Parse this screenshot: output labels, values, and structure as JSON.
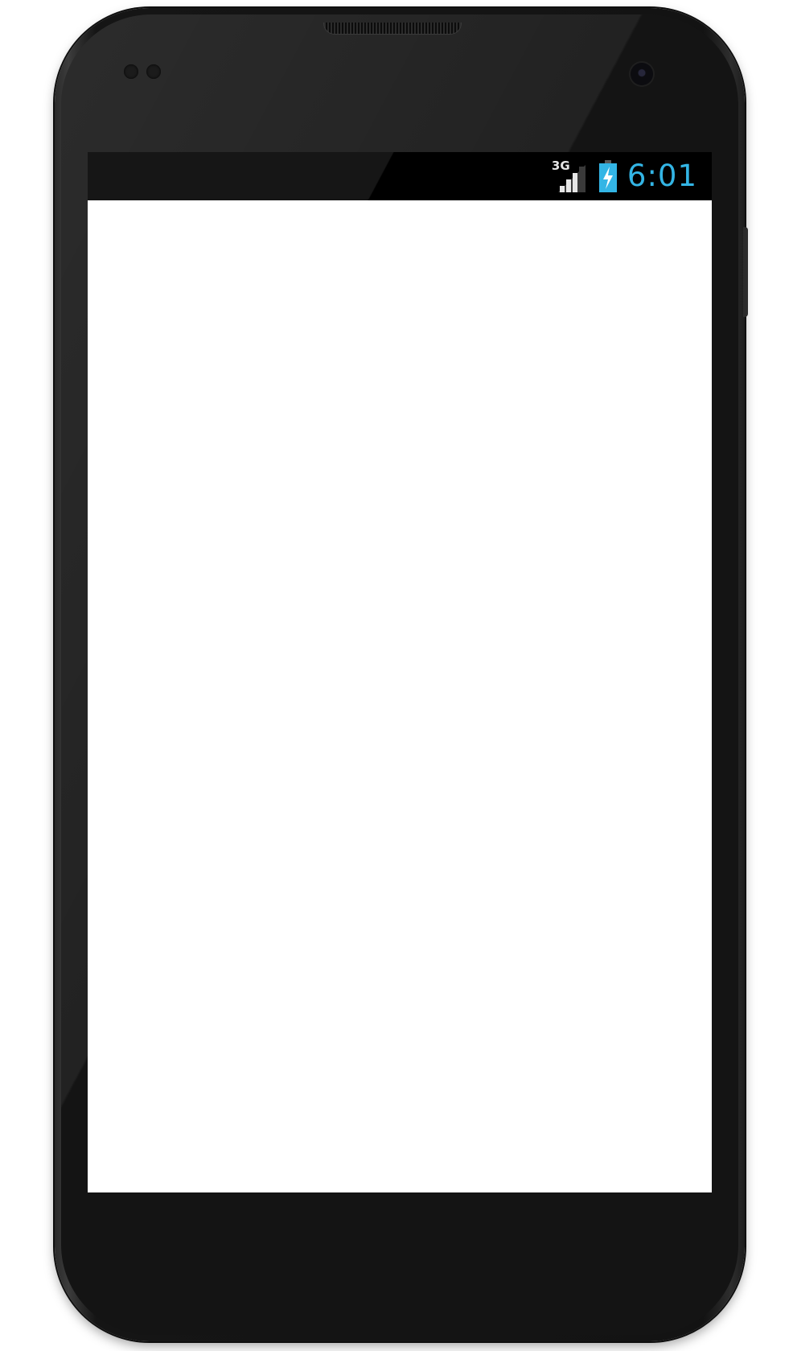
{
  "status_bar": {
    "network_type": "3G",
    "time": "6:01",
    "signal_strength_level": 0.75,
    "battery_charging": true,
    "icons": {
      "signal": "cell-signal-icon",
      "battery": "battery-charging-icon"
    },
    "colors": {
      "clock": "#33b5e5",
      "battery_fill": "#33b5e5",
      "background": "#000000"
    }
  },
  "screen": {
    "background": "#ffffff"
  },
  "device": {
    "body_color": "#141414"
  }
}
